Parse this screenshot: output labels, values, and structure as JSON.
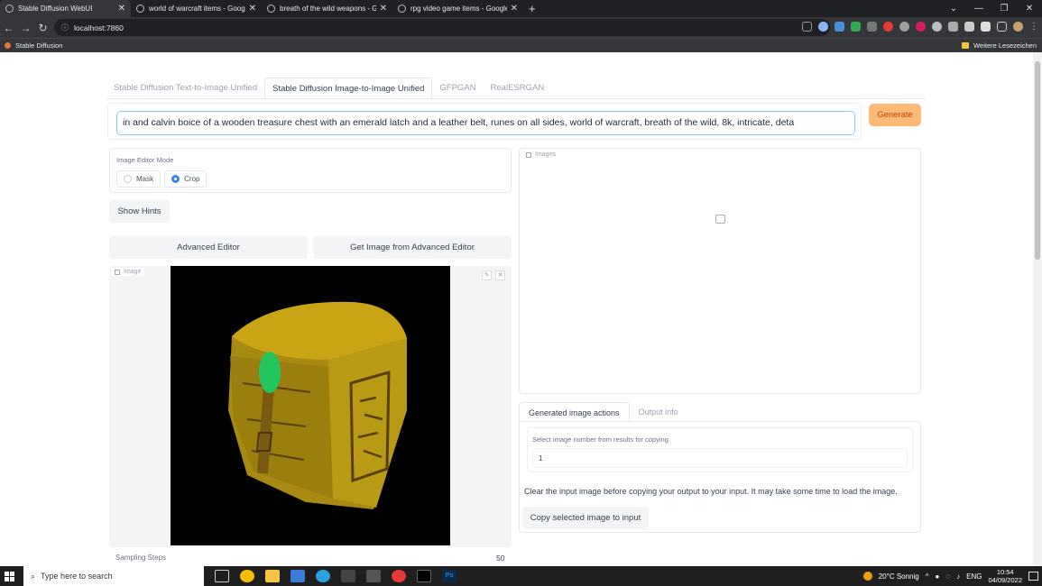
{
  "browser": {
    "tabs": [
      {
        "title": "Stable Diffusion WebUI",
        "active": true
      },
      {
        "title": "world of warcraft items - Google",
        "active": false
      },
      {
        "title": "breath of the wild weapons - Go",
        "active": false
      },
      {
        "title": "rpg video game items - Google",
        "active": false
      }
    ],
    "new_tab": "+",
    "url": "localhost:7860",
    "bookmark": "Stable Diffusion",
    "bookmarks_other": "Weitere Lesezeichen"
  },
  "app": {
    "tabs": [
      "Stable Diffusion Text-to-Image Unified",
      "Stable Diffusion Image-to-Image Unified",
      "GFPGAN",
      "RealESRGAN"
    ],
    "prompt": "in and calvin boice of a wooden treasure chest with an emerald latch and a leather belt, runes on all sides, world of warcraft, breath of the wild, 8k, intricate, deta",
    "generate_label": "Generate",
    "editor_mode": {
      "label": "Image Editor Mode",
      "options": [
        "Mask",
        "Crop"
      ],
      "selected": "Crop"
    },
    "show_hints_label": "Show Hints",
    "advanced_editor_label": "Advanced Editor",
    "get_image_label": "Get Image from Advanced Editor",
    "image_label": "Image",
    "images_label": "Images",
    "sampling_steps_label": "Sampling Steps",
    "sampling_steps_value": "50",
    "output_tabs": [
      "Generated image actions",
      "Output info"
    ],
    "select_label": "Select image number from results for copying",
    "select_value": "1",
    "clear_note": "Clear the input image before copying your output to your input. It may take some time to load the image.",
    "copy_button_label": "Copy selected image to input"
  },
  "taskbar": {
    "search_placeholder": "Type here to search",
    "weather": "20°C Sonnig",
    "lang": "ENG",
    "time": "10:54",
    "date": "04/09/2022"
  },
  "colors": {
    "accent_blue": "#3b82f6",
    "generate_orange": "#fdba74",
    "chest_gold": "#b8960f",
    "emerald": "#22c55e"
  }
}
